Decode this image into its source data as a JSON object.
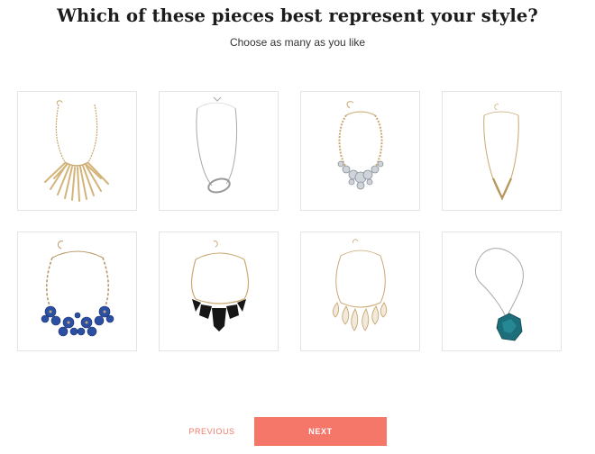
{
  "header": {
    "title": "Which of these pieces best represent your style?",
    "subtitle": "Choose as many as you like"
  },
  "options": [
    {
      "name": "gold-spike-statement-necklace"
    },
    {
      "name": "silver-circle-pendant-necklace"
    },
    {
      "name": "crystal-cluster-necklace"
    },
    {
      "name": "gold-v-chevron-necklace"
    },
    {
      "name": "blue-floral-bib-necklace"
    },
    {
      "name": "black-geometric-bib-necklace"
    },
    {
      "name": "pearl-leaf-bib-necklace"
    },
    {
      "name": "teal-stone-pendant-necklace"
    }
  ],
  "nav": {
    "previous_label": "PREVIOUS",
    "next_label": "NEXT"
  },
  "colors": {
    "accent": "#f4776a",
    "gold": "#c9a870",
    "silver": "#a8a8a8",
    "blue_stone": "#2b4fa3",
    "black_stone": "#161616",
    "teal_stone": "#1b6e7a"
  }
}
